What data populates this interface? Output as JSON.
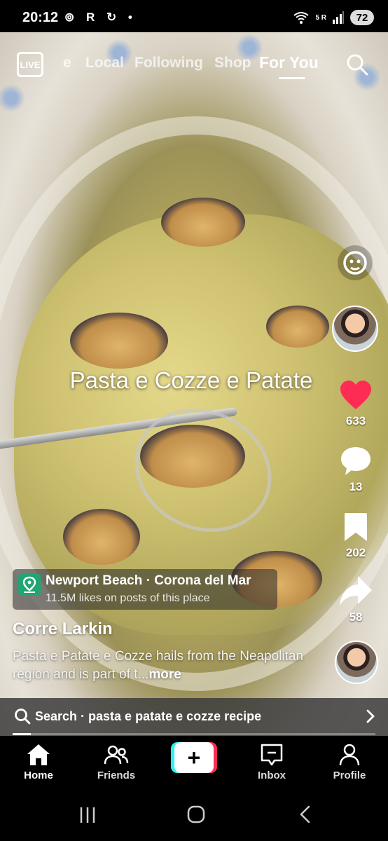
{
  "status_bar": {
    "time": "20:12",
    "left_icons": "⊚ R ↻ •",
    "network": "5 R",
    "battery": "72"
  },
  "top_nav": {
    "live_label": "LIVE",
    "tabs": [
      {
        "label": "e"
      },
      {
        "label": "Local"
      },
      {
        "label": "Following"
      },
      {
        "label": "Shop"
      },
      {
        "label": "For You"
      }
    ],
    "active_tab": "For You"
  },
  "video": {
    "overlay_text": "Pasta e Cozze e Patate"
  },
  "actions": {
    "likes": "633",
    "comments": "13",
    "saves": "202",
    "shares": "58",
    "like_color": "#fe2c55"
  },
  "location": {
    "title": "Newport Beach · Corona del Mar",
    "subtitle": "11.5M likes on posts of this place",
    "icon_color": "#1fa672"
  },
  "post": {
    "username": "Corre Larkin",
    "description": "Pasta e Patate e Cozze hails from the Neapolitan region and is part of t...",
    "more_label": "more"
  },
  "search_bar": {
    "label": "Search · pasta e patate e cozze recipe"
  },
  "progress": {
    "fraction": 0.05
  },
  "bottom_nav": {
    "items": [
      {
        "label": "Home",
        "icon": "home-icon"
      },
      {
        "label": "Friends",
        "icon": "friends-icon"
      },
      {
        "label": "Inbox",
        "icon": "inbox-icon"
      },
      {
        "label": "Profile",
        "icon": "profile-icon"
      }
    ],
    "create_label": "+",
    "active": "Home"
  }
}
